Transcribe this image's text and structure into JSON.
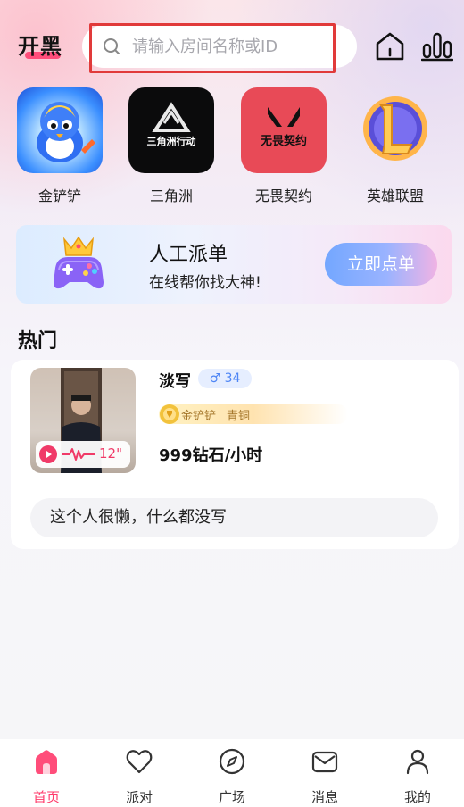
{
  "app": {
    "logo_text": "开黑"
  },
  "search": {
    "placeholder": "请输入房间名称或ID",
    "value": ""
  },
  "header_icons": [
    "home-icon",
    "leaderboard-icon"
  ],
  "games": [
    {
      "label": "金铲铲",
      "icon": "jcc-game-icon",
      "tile_text": ""
    },
    {
      "label": "三角洲",
      "icon": "sanjiaozhou-game-icon",
      "tile_text": "三角洲行动"
    },
    {
      "label": "无畏契约",
      "icon": "valorant-game-icon",
      "tile_text": "无畏契约"
    },
    {
      "label": "英雄联盟",
      "icon": "lol-game-icon",
      "tile_text": ""
    }
  ],
  "banner": {
    "title": "人工派单",
    "subtitle": "在线帮你找大神!",
    "button_label": "立即点单"
  },
  "hot": {
    "title": "热门",
    "cards": [
      {
        "name": "淡写",
        "gender_symbol": "♂",
        "age": "34",
        "voice_duration": "12\"",
        "skill_game": "金铲铲",
        "skill_rank": "青铜",
        "price": "999钻石/小时",
        "bio": "这个人很懒，什么都没写"
      }
    ]
  },
  "tabbar": {
    "active": "首页",
    "tabs": [
      {
        "label": "首页",
        "icon": "home-icon"
      },
      {
        "label": "派对",
        "icon": "heart-icon"
      },
      {
        "label": "广场",
        "icon": "compass-icon"
      },
      {
        "label": "消息",
        "icon": "mail-icon"
      },
      {
        "label": "我的",
        "icon": "user-icon"
      }
    ]
  },
  "colors": {
    "accent": "#ff3b6b",
    "focus_outline": "#e13a3a",
    "gender_male": "#4f86f5",
    "skill_text": "#a4762a"
  }
}
